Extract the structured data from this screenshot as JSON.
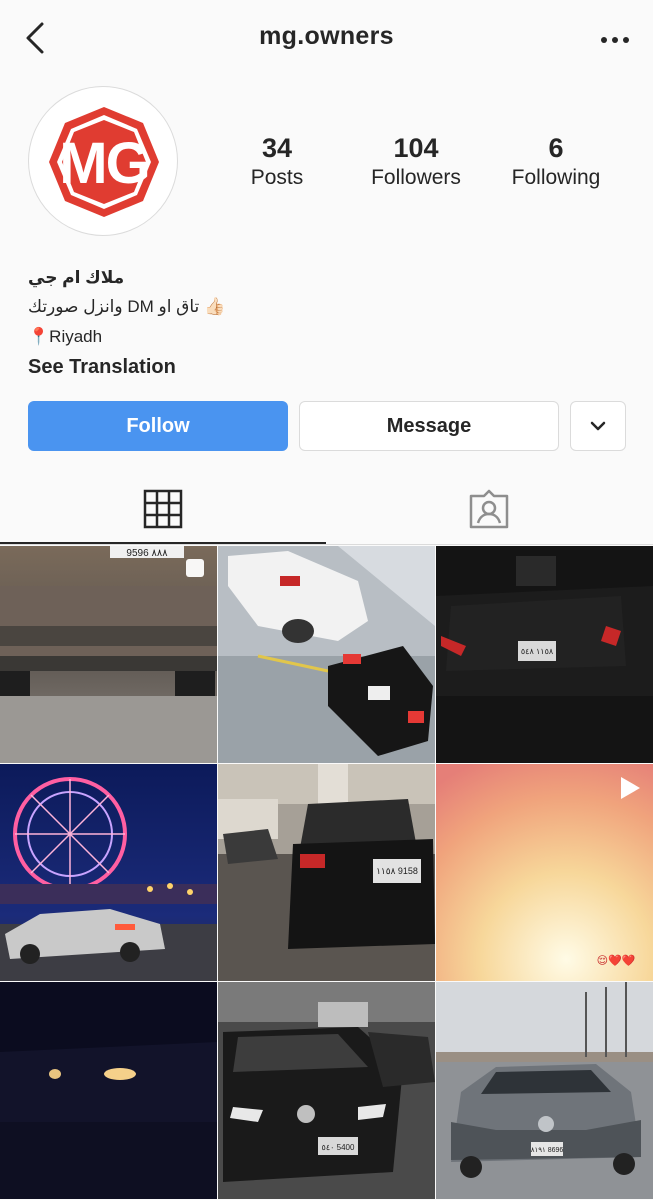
{
  "header": {
    "username": "mg.owners"
  },
  "profile": {
    "logo_text": "MG",
    "stats": [
      {
        "value": "34",
        "label": "Posts"
      },
      {
        "value": "104",
        "label": "Followers"
      },
      {
        "value": "6",
        "label": "Following"
      }
    ],
    "bio": {
      "name": "ملاك ام جي",
      "line1_text": "تاق او DM وانزل صورتك",
      "line1_emoji": "👍🏻",
      "location_emoji": "📍",
      "location": "Riyadh",
      "see_translation": "See Translation"
    }
  },
  "actions": {
    "follow": "Follow",
    "message": "Message"
  },
  "tabs": [
    {
      "name": "grid",
      "icon": "grid-icon",
      "active": true
    },
    {
      "name": "tagged",
      "icon": "tagged-icon",
      "active": false
    }
  ],
  "posts": [
    {
      "id": 1,
      "badge": "multiple-posts-icon",
      "plate": "9596 ٨٨٨"
    },
    {
      "id": 2
    },
    {
      "id": 3,
      "plate": "١١٥٨ ٥٤٨"
    },
    {
      "id": 4
    },
    {
      "id": 5,
      "plate": "١١٥٨ 9158"
    },
    {
      "id": 6,
      "badge": "video-play-icon",
      "overlay_emoji": "😌❤️❤️"
    },
    {
      "id": 7
    },
    {
      "id": 8,
      "plate": "٥٤٠ 5400"
    },
    {
      "id": 9,
      "plate": "٨١٩١ 8696"
    }
  ],
  "colors": {
    "follow_button": "#4a94f0",
    "logo_red": "#e03c31",
    "background": "#fafafa"
  }
}
